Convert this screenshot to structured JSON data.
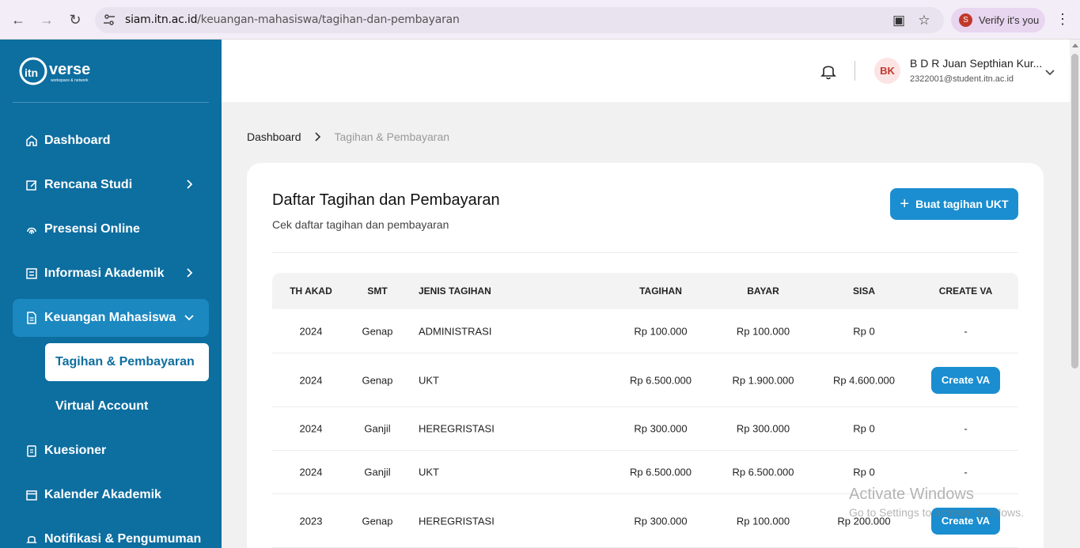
{
  "browser": {
    "url_host": "siam.itn.ac.id",
    "url_path": "/keuangan-mahasiswa/tagihan-dan-pembayaran",
    "profile_initial": "S",
    "verify_label": "Verify it's you"
  },
  "sidebar": {
    "logo_text": "verse",
    "logo_prefix": "itn",
    "logo_tagline": "workspace & network",
    "items": [
      {
        "label": "Dashboard"
      },
      {
        "label": "Rencana Studi"
      },
      {
        "label": "Presensi Online"
      },
      {
        "label": "Informasi Akademik"
      },
      {
        "label": "Keuangan Mahasiswa"
      },
      {
        "label": "Kuesioner"
      },
      {
        "label": "Kalender Akademik"
      },
      {
        "label": "Notifikasi & Pengumuman"
      }
    ],
    "subitems": [
      {
        "label": "Tagihan & Pembayaran"
      },
      {
        "label": "Virtual Account"
      }
    ]
  },
  "header": {
    "avatar_initials": "BK",
    "user_name": "B D R Juan Septhian Kur...",
    "user_email": "2322001@student.itn.ac.id"
  },
  "breadcrumb": {
    "home": "Dashboard",
    "current": "Tagihan & Pembayaran"
  },
  "card": {
    "title": "Daftar Tagihan dan Pembayaran",
    "subtitle": "Cek daftar tagihan dan pembayaran",
    "add_button": "Buat tagihan UKT"
  },
  "table": {
    "headers": [
      "TH AKAD",
      "SMT",
      "JENIS TAGIHAN",
      "TAGIHAN",
      "BAYAR",
      "SISA",
      "CREATE VA"
    ],
    "rows": [
      {
        "th": "2024",
        "smt": "Genap",
        "jenis": "ADMINISTRASI",
        "tagihan": "Rp 100.000",
        "bayar": "Rp 100.000",
        "sisa": "Rp 0",
        "va": "-"
      },
      {
        "th": "2024",
        "smt": "Genap",
        "jenis": "UKT",
        "tagihan": "Rp 6.500.000",
        "bayar": "Rp 1.900.000",
        "sisa": "Rp 4.600.000",
        "va": "Create VA"
      },
      {
        "th": "2024",
        "smt": "Ganjil",
        "jenis": "HEREGRISTASI",
        "tagihan": "Rp 300.000",
        "bayar": "Rp 300.000",
        "sisa": "Rp 0",
        "va": "-"
      },
      {
        "th": "2024",
        "smt": "Ganjil",
        "jenis": "UKT",
        "tagihan": "Rp 6.500.000",
        "bayar": "Rp 6.500.000",
        "sisa": "Rp 0",
        "va": "-"
      },
      {
        "th": "2023",
        "smt": "Genap",
        "jenis": "HEREGRISTASI",
        "tagihan": "Rp 300.000",
        "bayar": "Rp 100.000",
        "sisa": "Rp 200.000",
        "va": "Create VA"
      }
    ]
  },
  "watermark": {
    "line1": "Activate Windows",
    "line2": "Go to Settings to activate Windows."
  }
}
